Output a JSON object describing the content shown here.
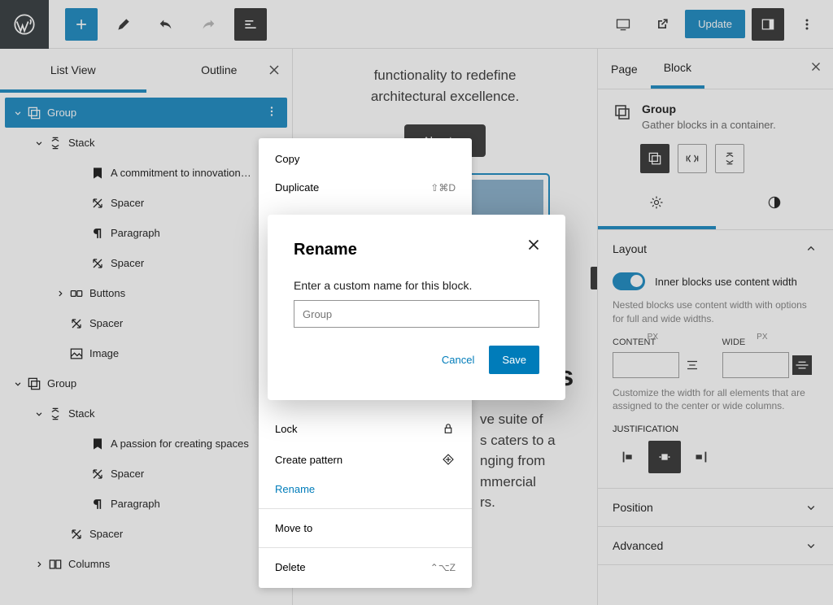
{
  "topbar": {
    "update_label": "Update"
  },
  "list_view": {
    "tab_list": "List View",
    "tab_outline": "Outline",
    "tree": [
      {
        "label": "Group",
        "indent": 0,
        "icon": "group",
        "chev": "down",
        "selected": true,
        "more": true
      },
      {
        "label": "Stack",
        "indent": 1,
        "icon": "stack",
        "chev": "down"
      },
      {
        "label": "A commitment to innovation…",
        "indent": 3,
        "icon": "heading"
      },
      {
        "label": "Spacer",
        "indent": 3,
        "icon": "spacer"
      },
      {
        "label": "Paragraph",
        "indent": 3,
        "icon": "paragraph"
      },
      {
        "label": "Spacer",
        "indent": 3,
        "icon": "spacer"
      },
      {
        "label": "Buttons",
        "indent": 2,
        "icon": "buttons",
        "chev": "right"
      },
      {
        "label": "Spacer",
        "indent": 2,
        "icon": "spacer"
      },
      {
        "label": "Image",
        "indent": 2,
        "icon": "image",
        "thumb": true
      },
      {
        "label": "Group",
        "indent": 0,
        "icon": "group",
        "chev": "down"
      },
      {
        "label": "Stack",
        "indent": 1,
        "icon": "stack",
        "chev": "down"
      },
      {
        "label": "A passion for creating spaces",
        "indent": 3,
        "icon": "heading"
      },
      {
        "label": "Spacer",
        "indent": 3,
        "icon": "spacer"
      },
      {
        "label": "Paragraph",
        "indent": 3,
        "icon": "paragraph"
      },
      {
        "label": "Spacer",
        "indent": 2,
        "icon": "spacer"
      },
      {
        "label": "Columns",
        "indent": 1,
        "icon": "columns",
        "chev": "right"
      }
    ]
  },
  "canvas": {
    "para1": "functionality to redefine",
    "para1b": "architectural excellence.",
    "about_btn": "About us",
    "heading": "n for\nspaces",
    "para2": "ve suite of\ns caters to a\nnging from\nmmercial\nrs."
  },
  "context_menu": {
    "copy": "Copy",
    "duplicate": "Duplicate",
    "duplicate_short": "⇧⌘D",
    "lock": "Lock",
    "create_pattern": "Create pattern",
    "rename": "Rename",
    "move_to": "Move to",
    "delete": "Delete",
    "delete_short": "⌃⌥Z"
  },
  "modal": {
    "title": "Rename",
    "label": "Enter a custom name for this block.",
    "placeholder": "Group",
    "cancel": "Cancel",
    "save": "Save"
  },
  "inspector": {
    "tab_page": "Page",
    "tab_block": "Block",
    "block_name": "Group",
    "block_desc": "Gather blocks in a container.",
    "layout_title": "Layout",
    "toggle_label": "Inner blocks use content width",
    "nested_help": "Nested blocks use content width with options for full and wide widths.",
    "content_label": "CONTENT",
    "wide_label": "WIDE",
    "width_unit": "PX",
    "custom_help": "Customize the width for all elements that are assigned to the center or wide columns.",
    "just_label": "JUSTIFICATION",
    "position_title": "Position",
    "advanced_title": "Advanced"
  }
}
